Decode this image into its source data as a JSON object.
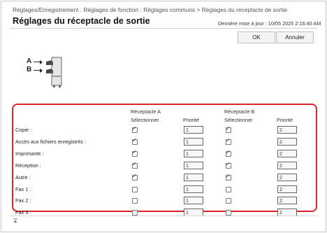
{
  "breadcrumb": "Réglages/Enregistrement : Réglages de fonction : Réglages communs > Réglages du réceptacle de sortie",
  "page_title": "Réglages du réceptacle de sortie",
  "last_updated": "Dernière mise à jour : 10/05 2025 2:16:40 AM",
  "buttons": {
    "ok": "OK",
    "cancel": "Annuler"
  },
  "diagram": {
    "label_a": "A",
    "label_b": "B"
  },
  "table": {
    "receptacle_a": {
      "title": "Réceptacle A",
      "select_label": "Sélectionner",
      "priority_label": "Priorité"
    },
    "receptacle_b": {
      "title": "Réceptacle B",
      "select_label": "Sélectionner",
      "priority_label": "Priorité"
    },
    "rows": [
      {
        "label": "Copie :",
        "a_checked": true,
        "a_priority": "1",
        "b_checked": true,
        "b_priority": "2"
      },
      {
        "label": "Accès aux fichiers enregistrés :",
        "a_checked": true,
        "a_priority": "1",
        "b_checked": true,
        "b_priority": "2"
      },
      {
        "label": "Imprimante :",
        "a_checked": true,
        "a_priority": "1",
        "b_checked": true,
        "b_priority": "2"
      },
      {
        "label": "Réception :",
        "a_checked": true,
        "a_priority": "1",
        "b_checked": true,
        "b_priority": "2"
      },
      {
        "label": "Autre :",
        "a_checked": true,
        "a_priority": "1",
        "b_checked": true,
        "b_priority": "2"
      },
      {
        "label": "Fax 1 :",
        "a_checked": false,
        "a_priority": "1",
        "b_checked": false,
        "b_priority": "2"
      },
      {
        "label": "Fax 2 :",
        "a_checked": false,
        "a_priority": "1",
        "b_checked": false,
        "b_priority": "2"
      },
      {
        "label": "Fax 3 :",
        "a_checked": false,
        "a_priority": "1",
        "b_checked": false,
        "b_priority": "2"
      }
    ]
  }
}
